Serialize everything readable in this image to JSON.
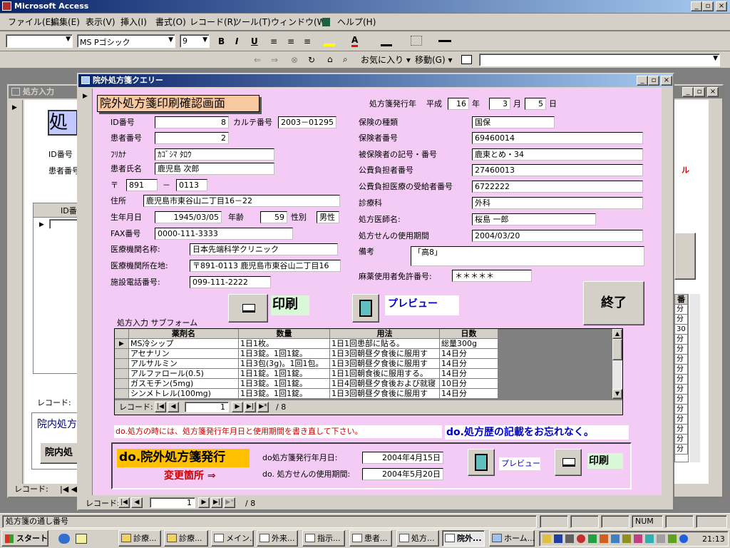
{
  "app": {
    "title": "Microsoft Access"
  },
  "menu": [
    "ファイル(E)",
    "編集(E)",
    "表示(V)",
    "挿入(I)",
    "書式(O)",
    "レコード(R)",
    "ツール(T)",
    "ウィンドウ(W)",
    "ヘルプ(H)"
  ],
  "formatting": {
    "font": "MS Pゴシック",
    "size": "9"
  },
  "web": {
    "favorites": "お気に入り",
    "goto": "移動(G)"
  },
  "bg_window": {
    "title": "処方入力",
    "big": "処",
    "id_label": "ID番号",
    "pt_label": "患者番号",
    "col": "ID番",
    "record_label": "レコード:",
    "inhouse": "院内処方",
    "inhouse_btn": "院内処",
    "red": "ル",
    "right_col": "番",
    "right_cells": [
      "分",
      "分",
      "30",
      "分",
      "分",
      "分",
      "分",
      "分",
      "分",
      "分",
      "分",
      "分",
      "分",
      "分",
      "分"
    ]
  },
  "window": {
    "title": "院外処方箋クエリー"
  },
  "form": {
    "heading": "院外処方箋印刷確認画面",
    "issue_label": "処方箋発行年",
    "era": "平成",
    "year": "16",
    "year_u": "年",
    "month": "3",
    "month_u": "月",
    "day": "5",
    "day_u": "日",
    "left": [
      {
        "label": "ID番号",
        "value": "8"
      },
      {
        "label": "カルテ番号",
        "value": "2003－01295"
      },
      {
        "label": "患者番号",
        "value": "2"
      },
      {
        "label": "ﾌﾘｶﾅ",
        "value": "ｶｺﾞｼﾏ ﾀﾛｳ"
      },
      {
        "label": "患者氏名",
        "value": "鹿児島 次郎"
      },
      {
        "label": "〒",
        "value": "891"
      },
      {
        "label": "－",
        "value": "0113"
      },
      {
        "label": "住所",
        "value": "鹿児島市東谷山二丁目16－22"
      },
      {
        "label": "生年月日",
        "value": "1945/03/05"
      },
      {
        "label": "年齢",
        "value": "59"
      },
      {
        "label": "性別",
        "value": "男性"
      },
      {
        "label": "FAX番号",
        "value": "0000-111-3333"
      },
      {
        "label": "医療機関名称:",
        "value": "日本先端科学クリニック"
      },
      {
        "label": "医療機関所在地:",
        "value": "〒891-0113  鹿児島市東谷山二丁目16"
      },
      {
        "label": "施設電話番号:",
        "value": "099-111-2222"
      }
    ],
    "right": [
      {
        "label": "保険の種類",
        "value": "国保"
      },
      {
        "label": "保険者番号",
        "value": "69460014"
      },
      {
        "label": "被保険者の記号・番号",
        "value": "鹿東とめ・34"
      },
      {
        "label": "公費負担者番号",
        "value": "27460013"
      },
      {
        "label": "公費負担医療の受給者番号",
        "value": "6722222"
      },
      {
        "label": "診療科",
        "value": "外科"
      },
      {
        "label": "処方医師名:",
        "value": "桜島 一郎"
      },
      {
        "label": "処方せんの使用期間",
        "value": "2004/03/20"
      },
      {
        "label": "備考",
        "value": "「高8」"
      },
      {
        "label": "麻薬使用者免許番号:",
        "value": "＊＊＊＊＊"
      }
    ],
    "print_label": "印刷",
    "preview_label": "プレビュー",
    "exit_label": "終了",
    "subform_label": "処方入力 サブフォーム",
    "grid": {
      "headers": [
        "薬剤名",
        "数量",
        "用法",
        "日数"
      ],
      "rows": [
        [
          "MS冷シップ",
          "1日1枚。",
          "1日1回患部に貼る。",
          "総量300g"
        ],
        [
          "アセナリン",
          "1日3錠。1回1錠。",
          "1日3回朝昼夕食後に服用す",
          "14日分"
        ],
        [
          "アルサルミン",
          "1日3包(3g)。1回1包。",
          "1日3回朝昼夕食後に服用す",
          "14日分"
        ],
        [
          "アルファロール(0.5)",
          "1日1錠。1回1錠。",
          "1日1回朝食後に服用する。",
          "14日分"
        ],
        [
          "ガスモチン(5mg)",
          "1日3錠。1回1錠。",
          "1日4回朝昼夕食後および就寝",
          "10日分"
        ],
        [
          "シンメトレル(100mg)",
          "1日3錠。1回1錠。",
          "1日3回朝昼夕食後に服用す",
          "14日分"
        ]
      ]
    },
    "sub_nav": {
      "label": "レコード:",
      "current": "1",
      "total": "/ 8"
    },
    "notice_red": "do.処方の時には、処方箋発行年月日と使用期間を書き直して下さい。",
    "notice_blue": "do.処方歴の記載をお忘れなく。",
    "do_title": "do.院外処方箋発行",
    "change_label": "変更箇所  ⇒",
    "do_issue_label": "do処方箋発行年月日:",
    "do_issue_value": "2004年4月15日",
    "do_period_label": "do. 処方せんの使用期間:",
    "do_period_value": "2004年5月20日",
    "do_preview": "プレビュー",
    "do_print": "印刷"
  },
  "main_nav": {
    "label": "レコード:",
    "current": "1",
    "total": "/ 8"
  },
  "status": {
    "text": "処方箋の通し番号",
    "num": "NUM"
  },
  "taskbar": {
    "start": "スタート",
    "items": [
      "診療...",
      "診療...",
      "メイン...",
      "外来...",
      "指示...",
      "患者...",
      "処方...",
      "院外...",
      "ホーム..."
    ],
    "clock": "21:13"
  },
  "colors": {
    "titlebar": "#0a246a",
    "form_bg": "#f4cbf4",
    "heading_bg": "#f8c8a0",
    "do_title_bg": "#ffc000",
    "blue_text": "#0000cc",
    "red_text": "#cc0000"
  }
}
